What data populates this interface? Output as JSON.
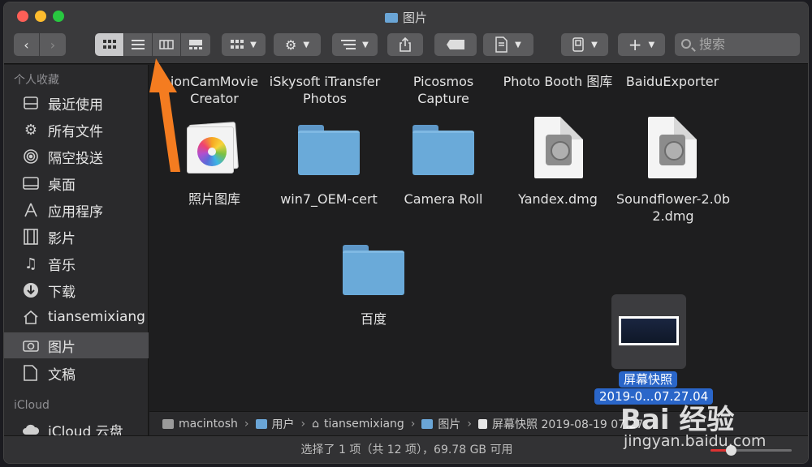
{
  "window": {
    "title": "图片"
  },
  "toolbar": {
    "back_icon": "chevron-left-icon",
    "forward_icon": "chevron-right-icon",
    "views": [
      "icon-view",
      "list-view",
      "column-view",
      "gallery-view"
    ],
    "group_icon": "grid-group-icon",
    "action_icon": "gear-icon",
    "arrange_icon": "arrange-icon",
    "share_icon": "share-icon",
    "tag_icon": "tag-icon",
    "get_info_icon": "doc-info-icon",
    "device_icon": "device-icon",
    "add_icon": "plus-icon",
    "search_placeholder": "搜索"
  },
  "sidebar": {
    "favorites_header": "个人收藏",
    "items": [
      {
        "label": "最近使用",
        "icon": "recents-icon"
      },
      {
        "label": "所有文件",
        "icon": "gear-icon"
      },
      {
        "label": "隔空投送",
        "icon": "airdrop-icon"
      },
      {
        "label": "桌面",
        "icon": "desktop-icon"
      },
      {
        "label": "应用程序",
        "icon": "applications-icon"
      },
      {
        "label": "影片",
        "icon": "movie-icon"
      },
      {
        "label": "音乐",
        "icon": "music-icon"
      },
      {
        "label": "下载",
        "icon": "download-icon"
      },
      {
        "label": "tiansemixiang",
        "icon": "home-icon"
      },
      {
        "label": "图片",
        "icon": "camera-icon"
      },
      {
        "label": "文稿",
        "icon": "documents-icon"
      }
    ],
    "icloud_header": "iCloud",
    "icloud_items": [
      {
        "label": "iCloud 云盘",
        "icon": "cloud-icon"
      }
    ]
  },
  "files": {
    "row1": [
      {
        "line1": "ionCamMovie",
        "line2": "Creator"
      },
      {
        "line1": "iSkysoft iTransfer",
        "line2": "Photos"
      },
      {
        "line1": "Picosmos",
        "line2": "Capture"
      },
      {
        "line1": "Photo Booth 图库",
        "line2": ""
      },
      {
        "line1": "BaiduExporter",
        "line2": ""
      }
    ],
    "row2": [
      {
        "name": "照片图库",
        "kind": "photos-library"
      },
      {
        "name": "win7_OEM-cert",
        "kind": "folder"
      },
      {
        "name": "Camera Roll",
        "kind": "folder"
      },
      {
        "name": "Yandex.dmg",
        "kind": "dmg"
      },
      {
        "name_line1": "Soundflower-2.0b",
        "name_line2": "2.dmg",
        "kind": "dmg"
      }
    ],
    "row3": [
      {
        "name": "百度",
        "kind": "folder"
      },
      {
        "name_line1": "屏幕快照",
        "name_line2": "2019-0...07.27.04",
        "kind": "screenshot",
        "selected": true
      }
    ]
  },
  "pathbar": {
    "segments": [
      "macintosh",
      "用户",
      "tiansemixiang",
      "图片",
      "屏幕快照 2019-08-19 07.27"
    ]
  },
  "status": {
    "text": "选择了 1 项（共 12 项），69.78 GB 可用",
    "zoom_level": 0.25
  },
  "watermark": {
    "brand": "Bai 经验",
    "url": "jingyan.baidu.com"
  },
  "colors": {
    "selection": "#2a66c9",
    "folder": "#6aaad9",
    "annotation_arrow": "#f47c20"
  }
}
